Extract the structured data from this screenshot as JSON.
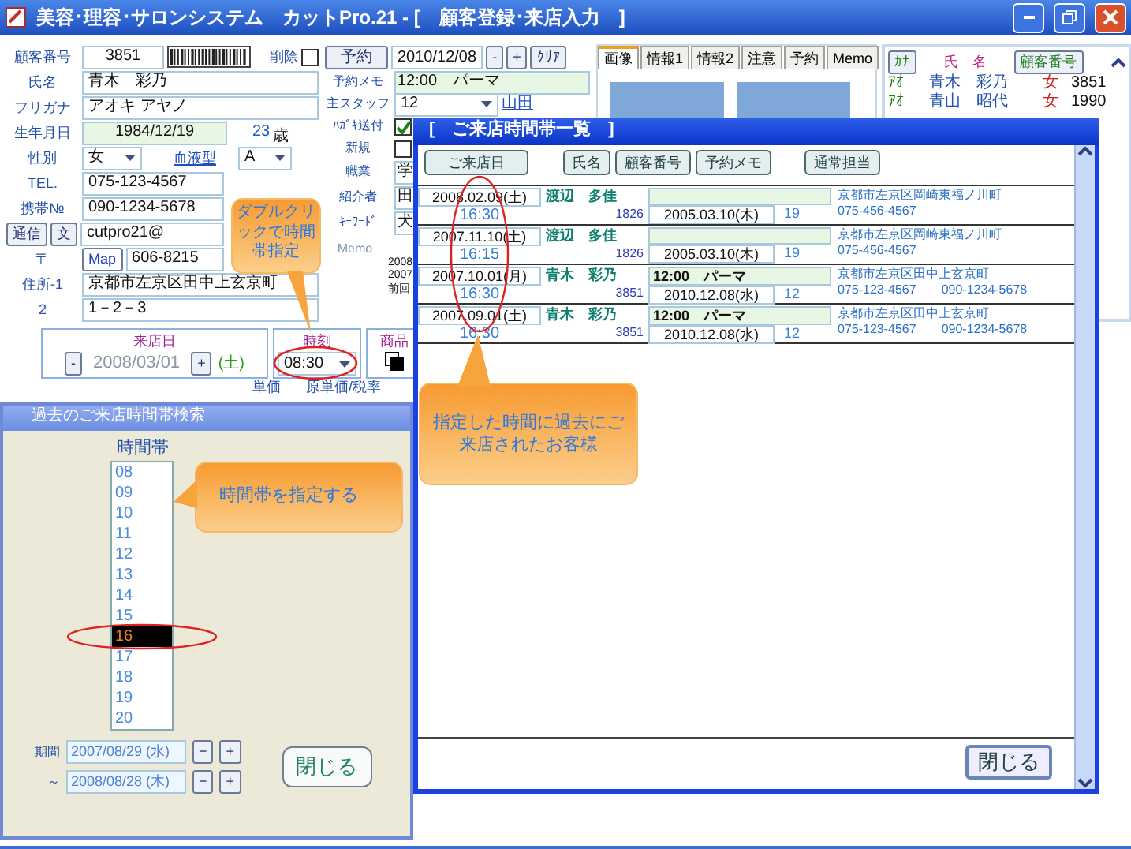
{
  "window": {
    "title": "美容･理容･サロンシステム　カットPro.21 - [　顧客登録･来店入力　]"
  },
  "left_rows": [
    {
      "kind": "id",
      "label": "顧客番号",
      "value": "3851",
      "delete_label": "削除",
      "deleted": false
    },
    {
      "kind": "text",
      "label": "氏名",
      "value": "青木　彩乃"
    },
    {
      "kind": "text",
      "label": "フリガナ",
      "value": "アオキ アヤノ"
    },
    {
      "kind": "birth",
      "label": "生年月日",
      "value": "1984/12/19",
      "age": "23",
      "age_unit": "歳"
    },
    {
      "kind": "select_pair",
      "label": "性別",
      "value": "女",
      "label2": "血液型",
      "value2": "A"
    },
    {
      "kind": "text",
      "label": "TEL.",
      "value": "075-123-4567"
    },
    {
      "kind": "text",
      "label": "携帯№",
      "value": "090-1234-5678"
    },
    {
      "kind": "mail",
      "buttons": [
        "通信",
        "文"
      ],
      "value": "cutpro21@"
    },
    {
      "kind": "zip",
      "label": "〒",
      "button": "Map",
      "value": "606-8215"
    },
    {
      "kind": "text",
      "label": "住所-1",
      "value": "京都市左京区田中上玄京町"
    },
    {
      "kind": "text",
      "label": "2",
      "value": "1－2－3"
    }
  ],
  "mid_rows": [
    {
      "kind": "reserve",
      "button": "予約",
      "value": "2010/12/08",
      "buttons": [
        "-",
        "+",
        "ｸﾘｱ"
      ]
    },
    {
      "kind": "text",
      "label": "予約メモ",
      "value": "12:00　パーマ"
    },
    {
      "kind": "staff",
      "label": "主スタッフ",
      "value": "12",
      "name": "山田"
    },
    {
      "kind": "check",
      "label": "ﾊｶﾞｷ送付",
      "checked": true
    },
    {
      "kind": "check",
      "label": "新規",
      "checked": false
    },
    {
      "kind": "text",
      "label": "職業",
      "value": "学"
    },
    {
      "kind": "text",
      "label": "紹介者",
      "value": "田"
    },
    {
      "kind": "text",
      "label": "ｷｰﾜｰﾄﾞ",
      "value": "犬"
    },
    {
      "kind": "memo",
      "label": "Memo",
      "lines": [
        "2008",
        "2007",
        "前回"
      ]
    }
  ],
  "right_panel": {
    "tabs": [
      {
        "label": "画像",
        "selected": true
      },
      {
        "label": "情報1",
        "selected": false
      },
      {
        "label": "情報2",
        "selected": false
      },
      {
        "label": "注意",
        "selected": false
      },
      {
        "label": "予約",
        "selected": false
      },
      {
        "label": "Memo",
        "selected": false
      }
    ],
    "list_header": {
      "kana": "ｶﾅ",
      "name": "氏　名",
      "number": "顧客番号"
    },
    "list_rows": [
      {
        "kana": "ｱｵ",
        "name": "青木　彩乃",
        "sex": "女",
        "number": "3851"
      },
      {
        "kana": "ｱｵ",
        "name": "青山　昭代",
        "sex": "女",
        "number": "1990"
      }
    ]
  },
  "visit": {
    "date_label": "来店日",
    "step_buttons": [
      "-",
      "+"
    ],
    "date": "2008/03/01",
    "weekday": "(土)",
    "time_label": "時刻",
    "time": "08:30",
    "goods_label": "商品",
    "columns": [
      "単価",
      "原単価/税率"
    ]
  },
  "time_dialog": {
    "title": "過去のご来店時間帯検索",
    "list_label": "時間帯",
    "hours": [
      {
        "label": "08",
        "selected": false
      },
      {
        "label": "09",
        "selected": false
      },
      {
        "label": "10",
        "selected": false
      },
      {
        "label": "11",
        "selected": false
      },
      {
        "label": "12",
        "selected": false
      },
      {
        "label": "13",
        "selected": false
      },
      {
        "label": "14",
        "selected": false
      },
      {
        "label": "15",
        "selected": false
      },
      {
        "label": "16",
        "selected": true
      },
      {
        "label": "17",
        "selected": false
      },
      {
        "label": "18",
        "selected": false
      },
      {
        "label": "19",
        "selected": false
      },
      {
        "label": "20",
        "selected": false
      }
    ],
    "period_label": "期間",
    "period_from": "2007/08/29 (水)",
    "period_sep": "～",
    "period_to": "2008/08/28 (木)",
    "step_buttons": [
      "−",
      "+"
    ],
    "close": "閉じる"
  },
  "visit_list": {
    "title": "[　ご来店時間帯一覧　]",
    "sort_buttons": [
      "ご来店日",
      "氏名",
      "顧客番号",
      "予約メモ",
      "通常担当"
    ],
    "rows": [
      {
        "date": "2008.02.09(土)",
        "time": "16:30",
        "name": "渡辺　多佳",
        "number": "1826",
        "next_date": "2005.03.10(木)",
        "count": "19",
        "address": "京都市左京区岡崎東福ノ川町",
        "tel": "075-456-4567"
      },
      {
        "date": "2007.11.10(土)",
        "time": "16:15",
        "name": "渡辺　多佳",
        "number": "1826",
        "next_date": "2005.03.10(木)",
        "count": "19",
        "address": "京都市左京区岡崎東福ノ川町",
        "tel": "075-456-4567"
      },
      {
        "date": "2007.10.01(月)",
        "time": "16:30",
        "name": "青木　彩乃",
        "number": "3851",
        "memo": "12:00　パーマ",
        "next_date": "2010.12.08(水)",
        "count": "12",
        "address": "京都市左京区田中上玄京町",
        "tel": "075-123-4567",
        "mobile": "090-1234-5678"
      },
      {
        "date": "2007.09.01(土)",
        "time": "16:30",
        "name": "青木　彩乃",
        "number": "3851",
        "memo": "12:00　パーマ",
        "next_date": "2010.12.08(水)",
        "count": "12",
        "address": "京都市左京区田中上玄京町",
        "tel": "075-123-4567",
        "mobile": "090-1234-5678"
      }
    ],
    "close": "閉じる"
  },
  "callouts": [
    "ダブルクリックで時間帯指定",
    "時間帯を指定する",
    "指定した時間に過去にご来店されたお客様"
  ]
}
